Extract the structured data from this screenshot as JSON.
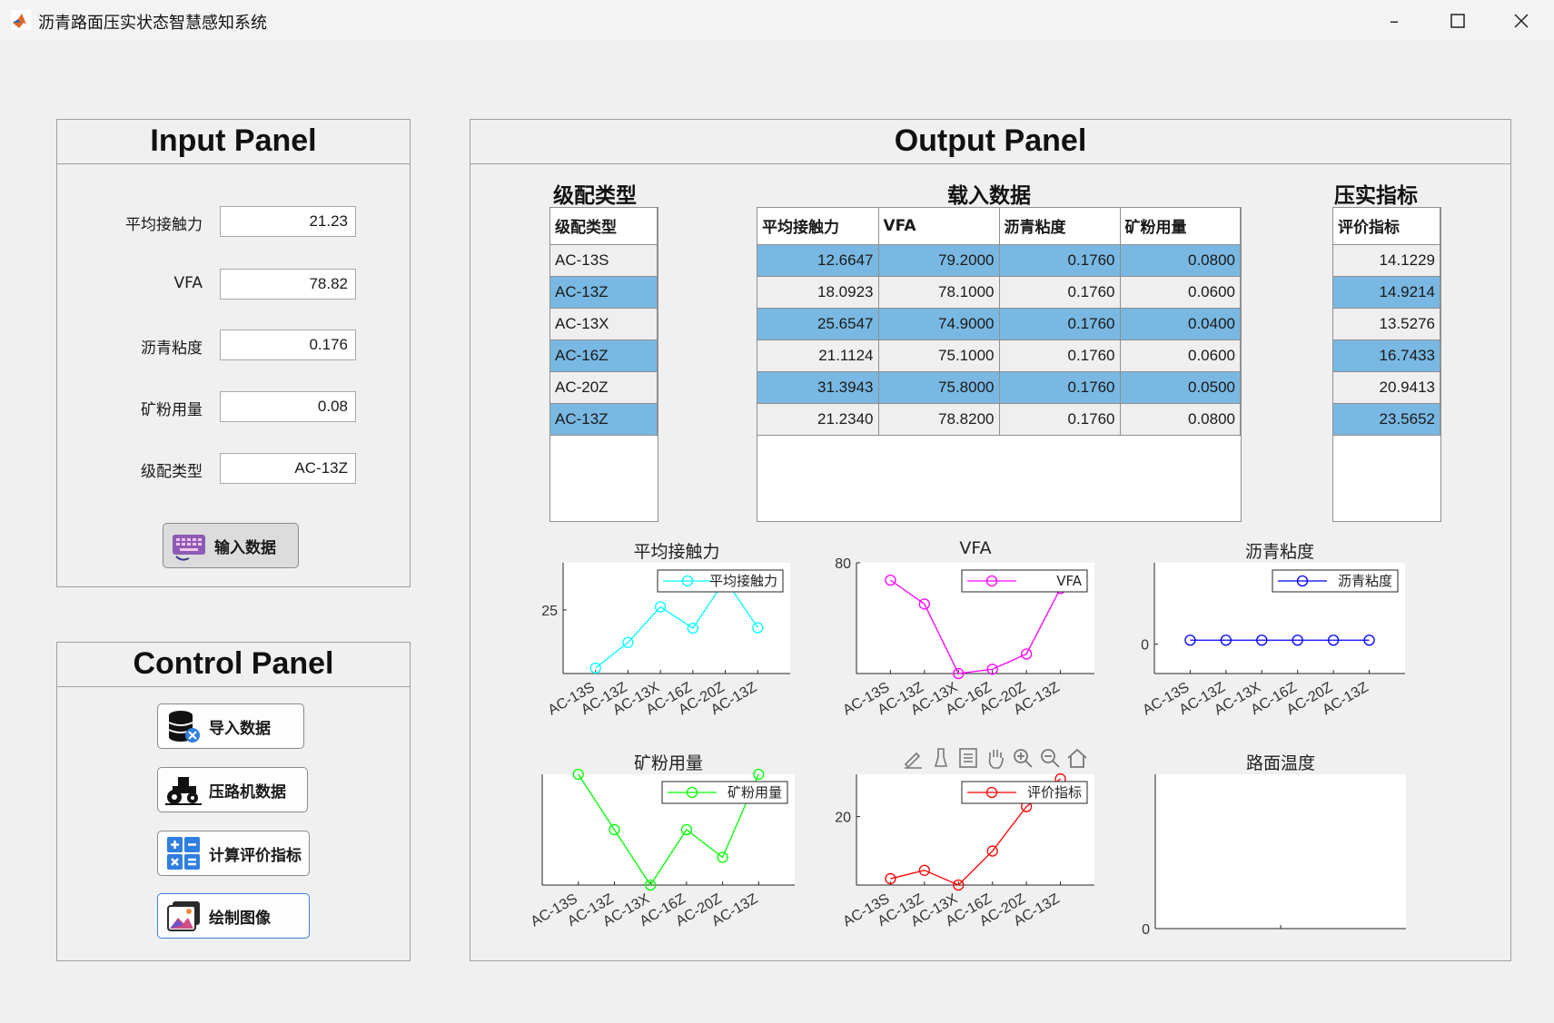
{
  "window": {
    "title": "沥青路面压实状态智慧感知系统"
  },
  "input_panel": {
    "title": "Input Panel",
    "fields": [
      {
        "label": "平均接触力",
        "value": "21.23"
      },
      {
        "label": "VFA",
        "value": "78.82"
      },
      {
        "label": "沥青粘度",
        "value": "0.176"
      },
      {
        "label": "矿粉用量",
        "value": "0.08"
      },
      {
        "label": "级配类型",
        "value": "AC-13Z"
      }
    ],
    "submit_label": "输入数据"
  },
  "control_panel": {
    "title": "Control Panel",
    "buttons": [
      {
        "label": "导入数据",
        "icon": "database-icon"
      },
      {
        "label": "压路机数据",
        "icon": "road-roller-icon"
      },
      {
        "label": "计算评价指标",
        "icon": "calculator-icon"
      },
      {
        "label": "绘制图像",
        "icon": "image-icon"
      }
    ]
  },
  "output_panel": {
    "title": "Output Panel",
    "grade_title": "级配类型",
    "grade_header": "级配类型",
    "grade_rows": [
      "AC-13S",
      "AC-13Z",
      "AC-13X",
      "AC-16Z",
      "AC-20Z",
      "AC-13Z"
    ],
    "load_title": "载入数据",
    "load_headers": [
      "平均接触力",
      "VFA",
      "沥青粘度",
      "矿粉用量"
    ],
    "load_rows": [
      [
        "12.6647",
        "79.2000",
        "0.1760",
        "0.0800"
      ],
      [
        "18.0923",
        "78.1000",
        "0.1760",
        "0.0600"
      ],
      [
        "25.6547",
        "74.9000",
        "0.1760",
        "0.0400"
      ],
      [
        "21.1124",
        "75.1000",
        "0.1760",
        "0.0600"
      ],
      [
        "31.3943",
        "75.8000",
        "0.1760",
        "0.0500"
      ],
      [
        "21.2340",
        "78.8200",
        "0.1760",
        "0.0800"
      ]
    ],
    "index_title": "压实指标",
    "index_header": "评价指标",
    "index_rows": [
      "14.1229",
      "14.9214",
      "13.5276",
      "16.7433",
      "20.9413",
      "23.5652"
    ]
  },
  "chart_data": [
    {
      "type": "line",
      "title": "平均接触力",
      "categories": [
        "AC-13S",
        "AC-13Z",
        "AC-13X",
        "AC-16Z",
        "AC-20Z",
        "AC-13Z"
      ],
      "series": [
        {
          "name": "平均接触力",
          "values": [
            12.6647,
            18.0923,
            25.6547,
            21.1124,
            31.3943,
            21.234
          ]
        }
      ],
      "ylim": [
        11.5,
        35
      ],
      "yticks": [
        25
      ],
      "color": "#00ffff"
    },
    {
      "type": "line",
      "title": "VFA",
      "categories": [
        "AC-13S",
        "AC-13Z",
        "AC-13X",
        "AC-16Z",
        "AC-20Z",
        "AC-13Z"
      ],
      "series": [
        {
          "name": "VFA",
          "values": [
            79.2,
            78.1,
            74.9,
            75.1,
            75.8,
            78.82
          ]
        }
      ],
      "ylim": [
        74.9,
        80
      ],
      "yticks": [
        80
      ],
      "color": "#ff00ff"
    },
    {
      "type": "line",
      "title": "沥青粘度",
      "categories": [
        "AC-13S",
        "AC-13Z",
        "AC-13X",
        "AC-16Z",
        "AC-20Z",
        "AC-13Z"
      ],
      "series": [
        {
          "name": "沥青粘度",
          "values": [
            0.176,
            0.176,
            0.176,
            0.176,
            0.176,
            0.176
          ]
        }
      ],
      "ylim": [
        -1.3,
        3.6
      ],
      "yticks": [
        0
      ],
      "color": "#0000ff"
    },
    {
      "type": "line",
      "title": "矿粉用量",
      "categories": [
        "AC-13S",
        "AC-13Z",
        "AC-13X",
        "AC-16Z",
        "AC-20Z",
        "AC-13Z"
      ],
      "series": [
        {
          "name": "矿粉用量",
          "values": [
            0.08,
            0.06,
            0.04,
            0.06,
            0.05,
            0.08
          ]
        }
      ],
      "ylim": [
        0.04,
        0.08
      ],
      "yticks": [],
      "color": "#00ff00"
    },
    {
      "type": "line",
      "title": "",
      "categories": [
        "AC-13S",
        "AC-13Z",
        "AC-13X",
        "AC-16Z",
        "AC-20Z",
        "AC-13Z"
      ],
      "series": [
        {
          "name": "评价指标",
          "values": [
            14.1229,
            14.9214,
            13.5276,
            16.7433,
            20.9413,
            23.5652
          ]
        }
      ],
      "ylim": [
        13.5276,
        24
      ],
      "yticks": [
        20
      ],
      "color": "#ff0000"
    },
    {
      "type": "line",
      "title": "路面温度",
      "categories": [],
      "series": [],
      "ylim": [
        0,
        1
      ],
      "yticks": [
        0
      ]
    }
  ],
  "plot_toolbar": {
    "icons": [
      "brush-annotate-icon",
      "data-tip-icon",
      "data-cursor-icon",
      "pan-icon",
      "zoom-in-icon",
      "zoom-out-icon",
      "home-icon"
    ]
  }
}
